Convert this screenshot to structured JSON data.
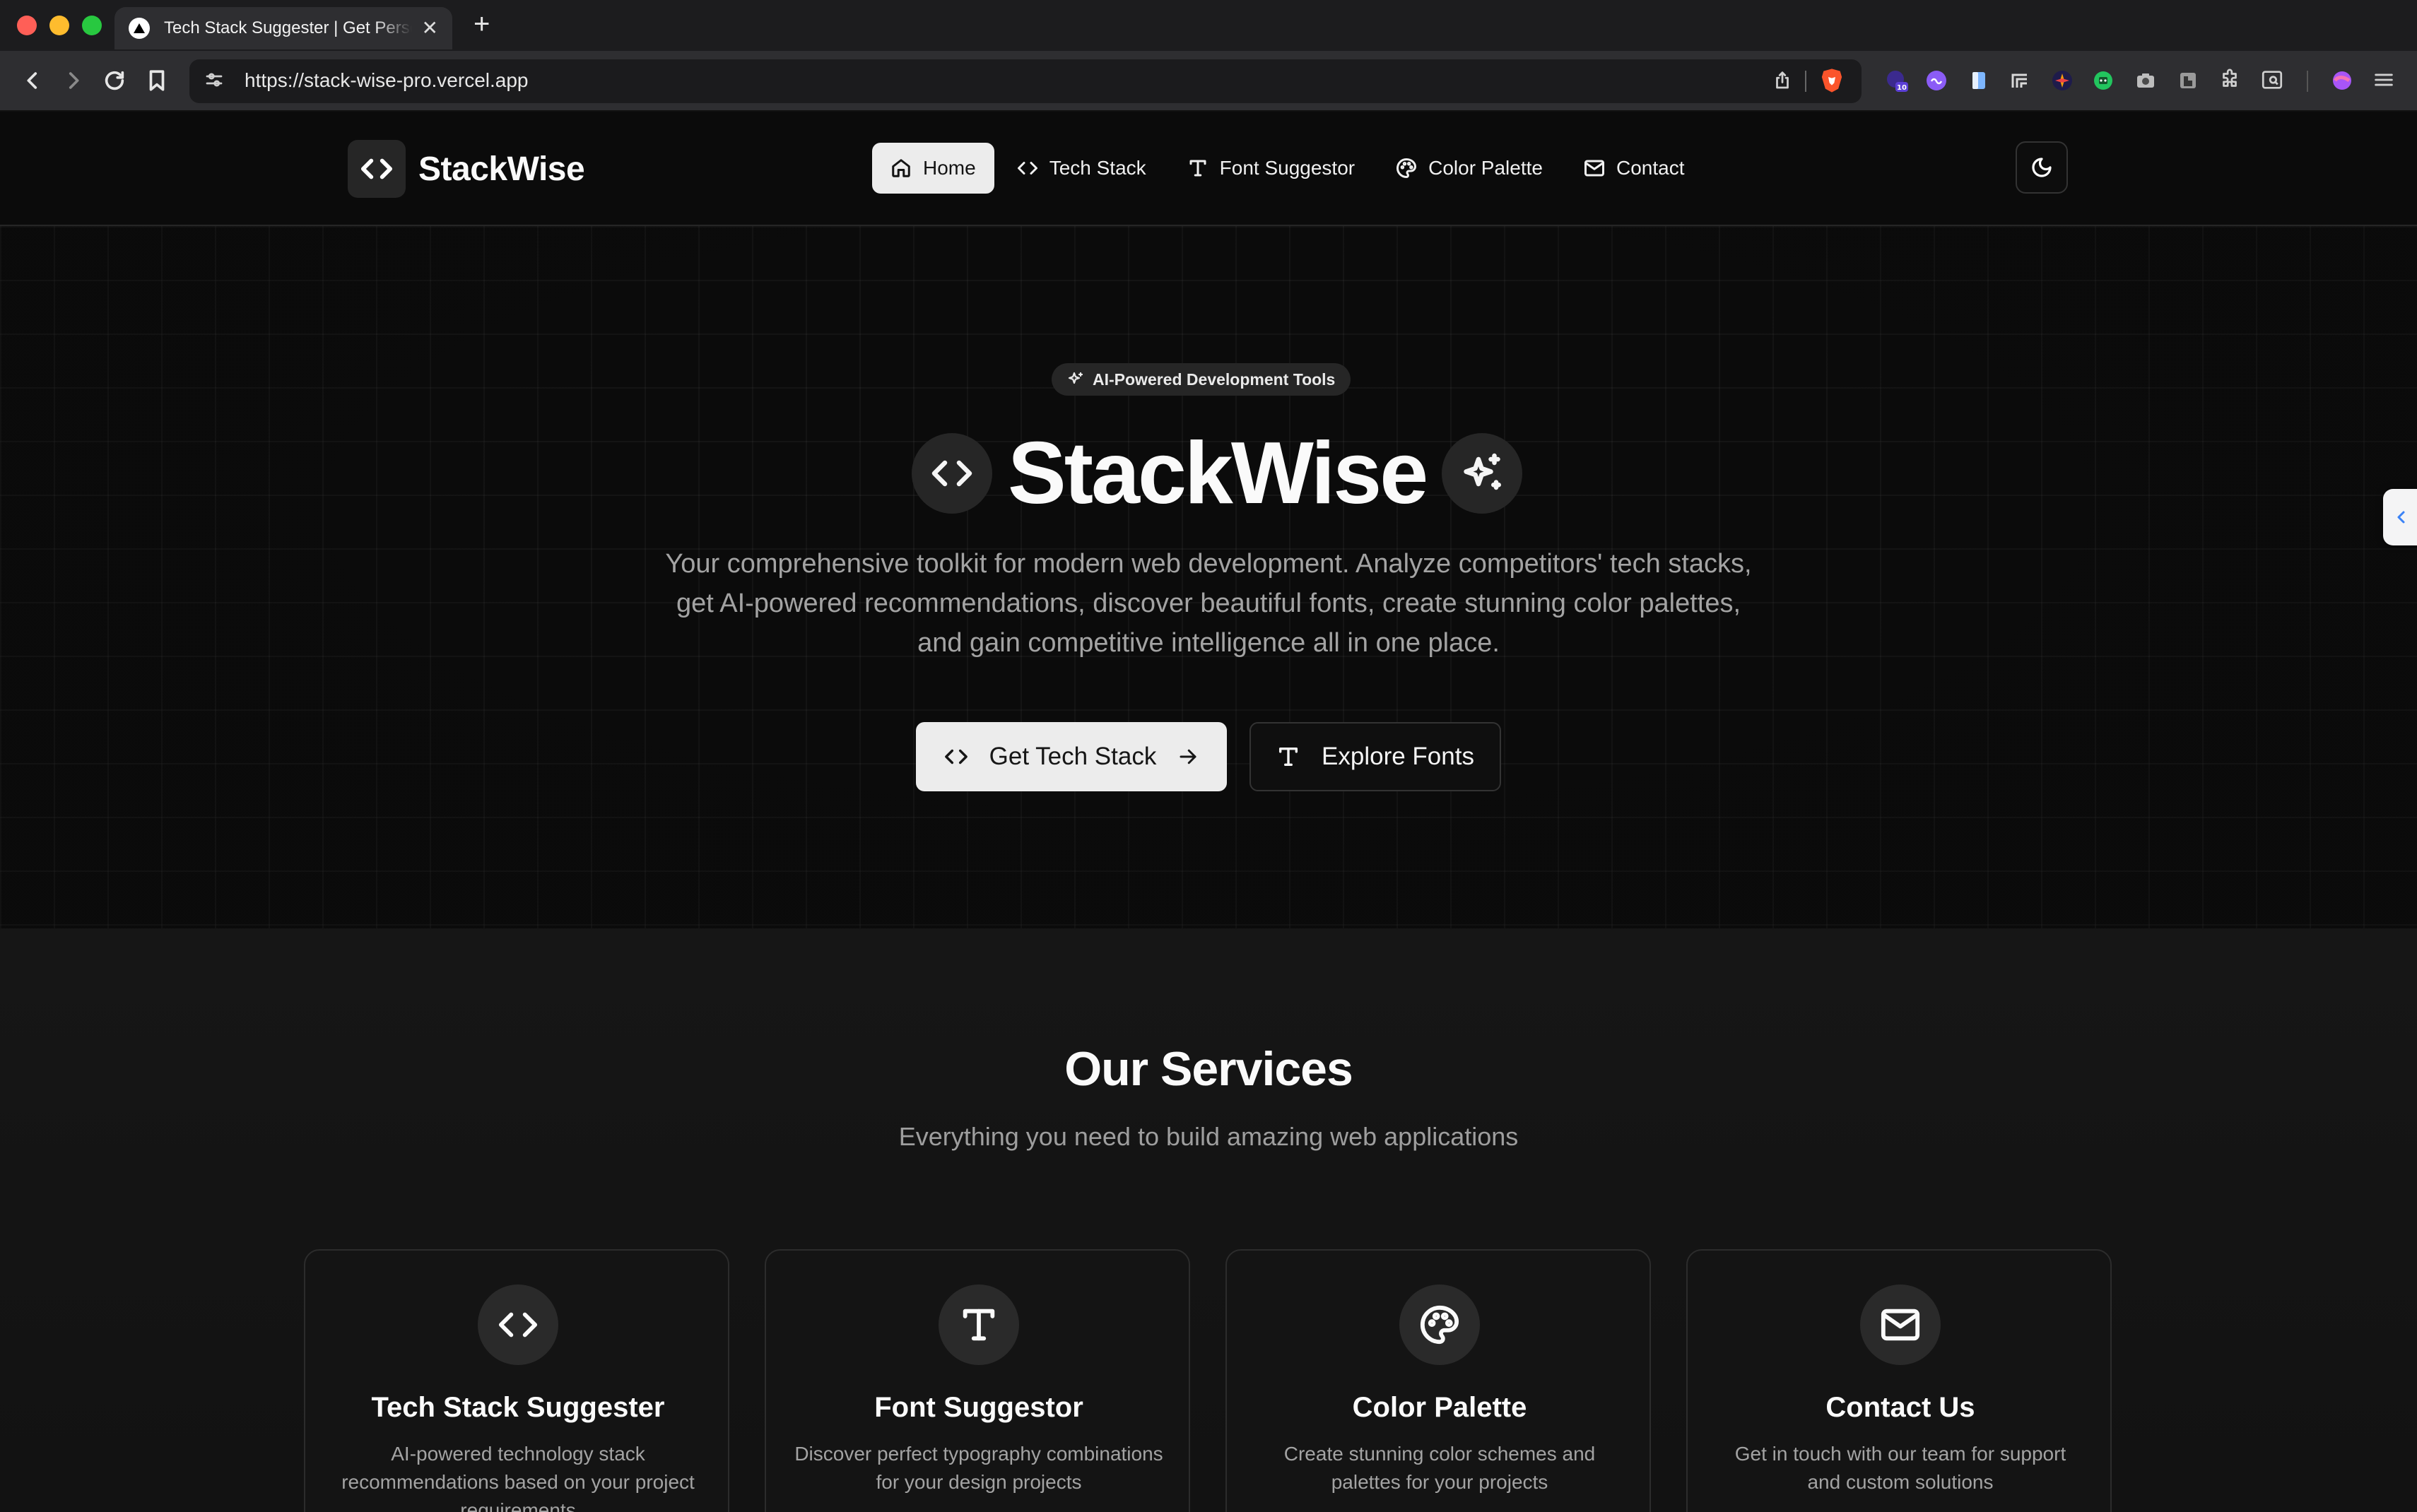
{
  "browser": {
    "tab_title": "Tech Stack Suggester | Get Personalized Recommendations",
    "tab_close": "✕",
    "new_tab": "+",
    "url": "https://stack-wise-pro.vercel.app",
    "extension_badge": "10"
  },
  "header": {
    "logo_text": "StackWise",
    "nav": [
      {
        "label": "Home",
        "icon": "home-icon",
        "active": true
      },
      {
        "label": "Tech Stack",
        "icon": "code-icon"
      },
      {
        "label": "Font Suggestor",
        "icon": "type-icon"
      },
      {
        "label": "Color Palette",
        "icon": "palette-icon"
      },
      {
        "label": "Contact",
        "icon": "mail-icon"
      }
    ],
    "theme_toggle_icon": "moon-icon"
  },
  "hero": {
    "badge": "AI-Powered Development Tools",
    "title": "StackWise",
    "description": "Your comprehensive toolkit for modern web development. Analyze competitors' tech stacks, get AI-powered recommendations, discover beautiful fonts, create stunning color palettes, and gain competitive intelligence all in one place.",
    "primary_button": "Get Tech Stack",
    "secondary_button": "Explore Fonts"
  },
  "services": {
    "title": "Our Services",
    "subtitle": "Everything you need to build amazing web applications",
    "cards": [
      {
        "title": "Tech Stack Suggester",
        "description": "AI-powered technology stack recommendations based on your project requirements",
        "icon": "code-icon"
      },
      {
        "title": "Font Suggestor",
        "description": "Discover perfect typography combinations for your design projects",
        "icon": "type-icon"
      },
      {
        "title": "Color Palette",
        "description": "Create stunning color schemes and palettes for your projects",
        "icon": "palette-icon"
      },
      {
        "title": "Contact Us",
        "description": "Get in touch with our team for support and custom solutions",
        "icon": "mail-icon"
      }
    ]
  },
  "colors": {
    "background": "#0a0a0a",
    "primary_button": "#ececec",
    "muted_text": "#a3a3a3",
    "card_border": "#2c2c2c"
  }
}
